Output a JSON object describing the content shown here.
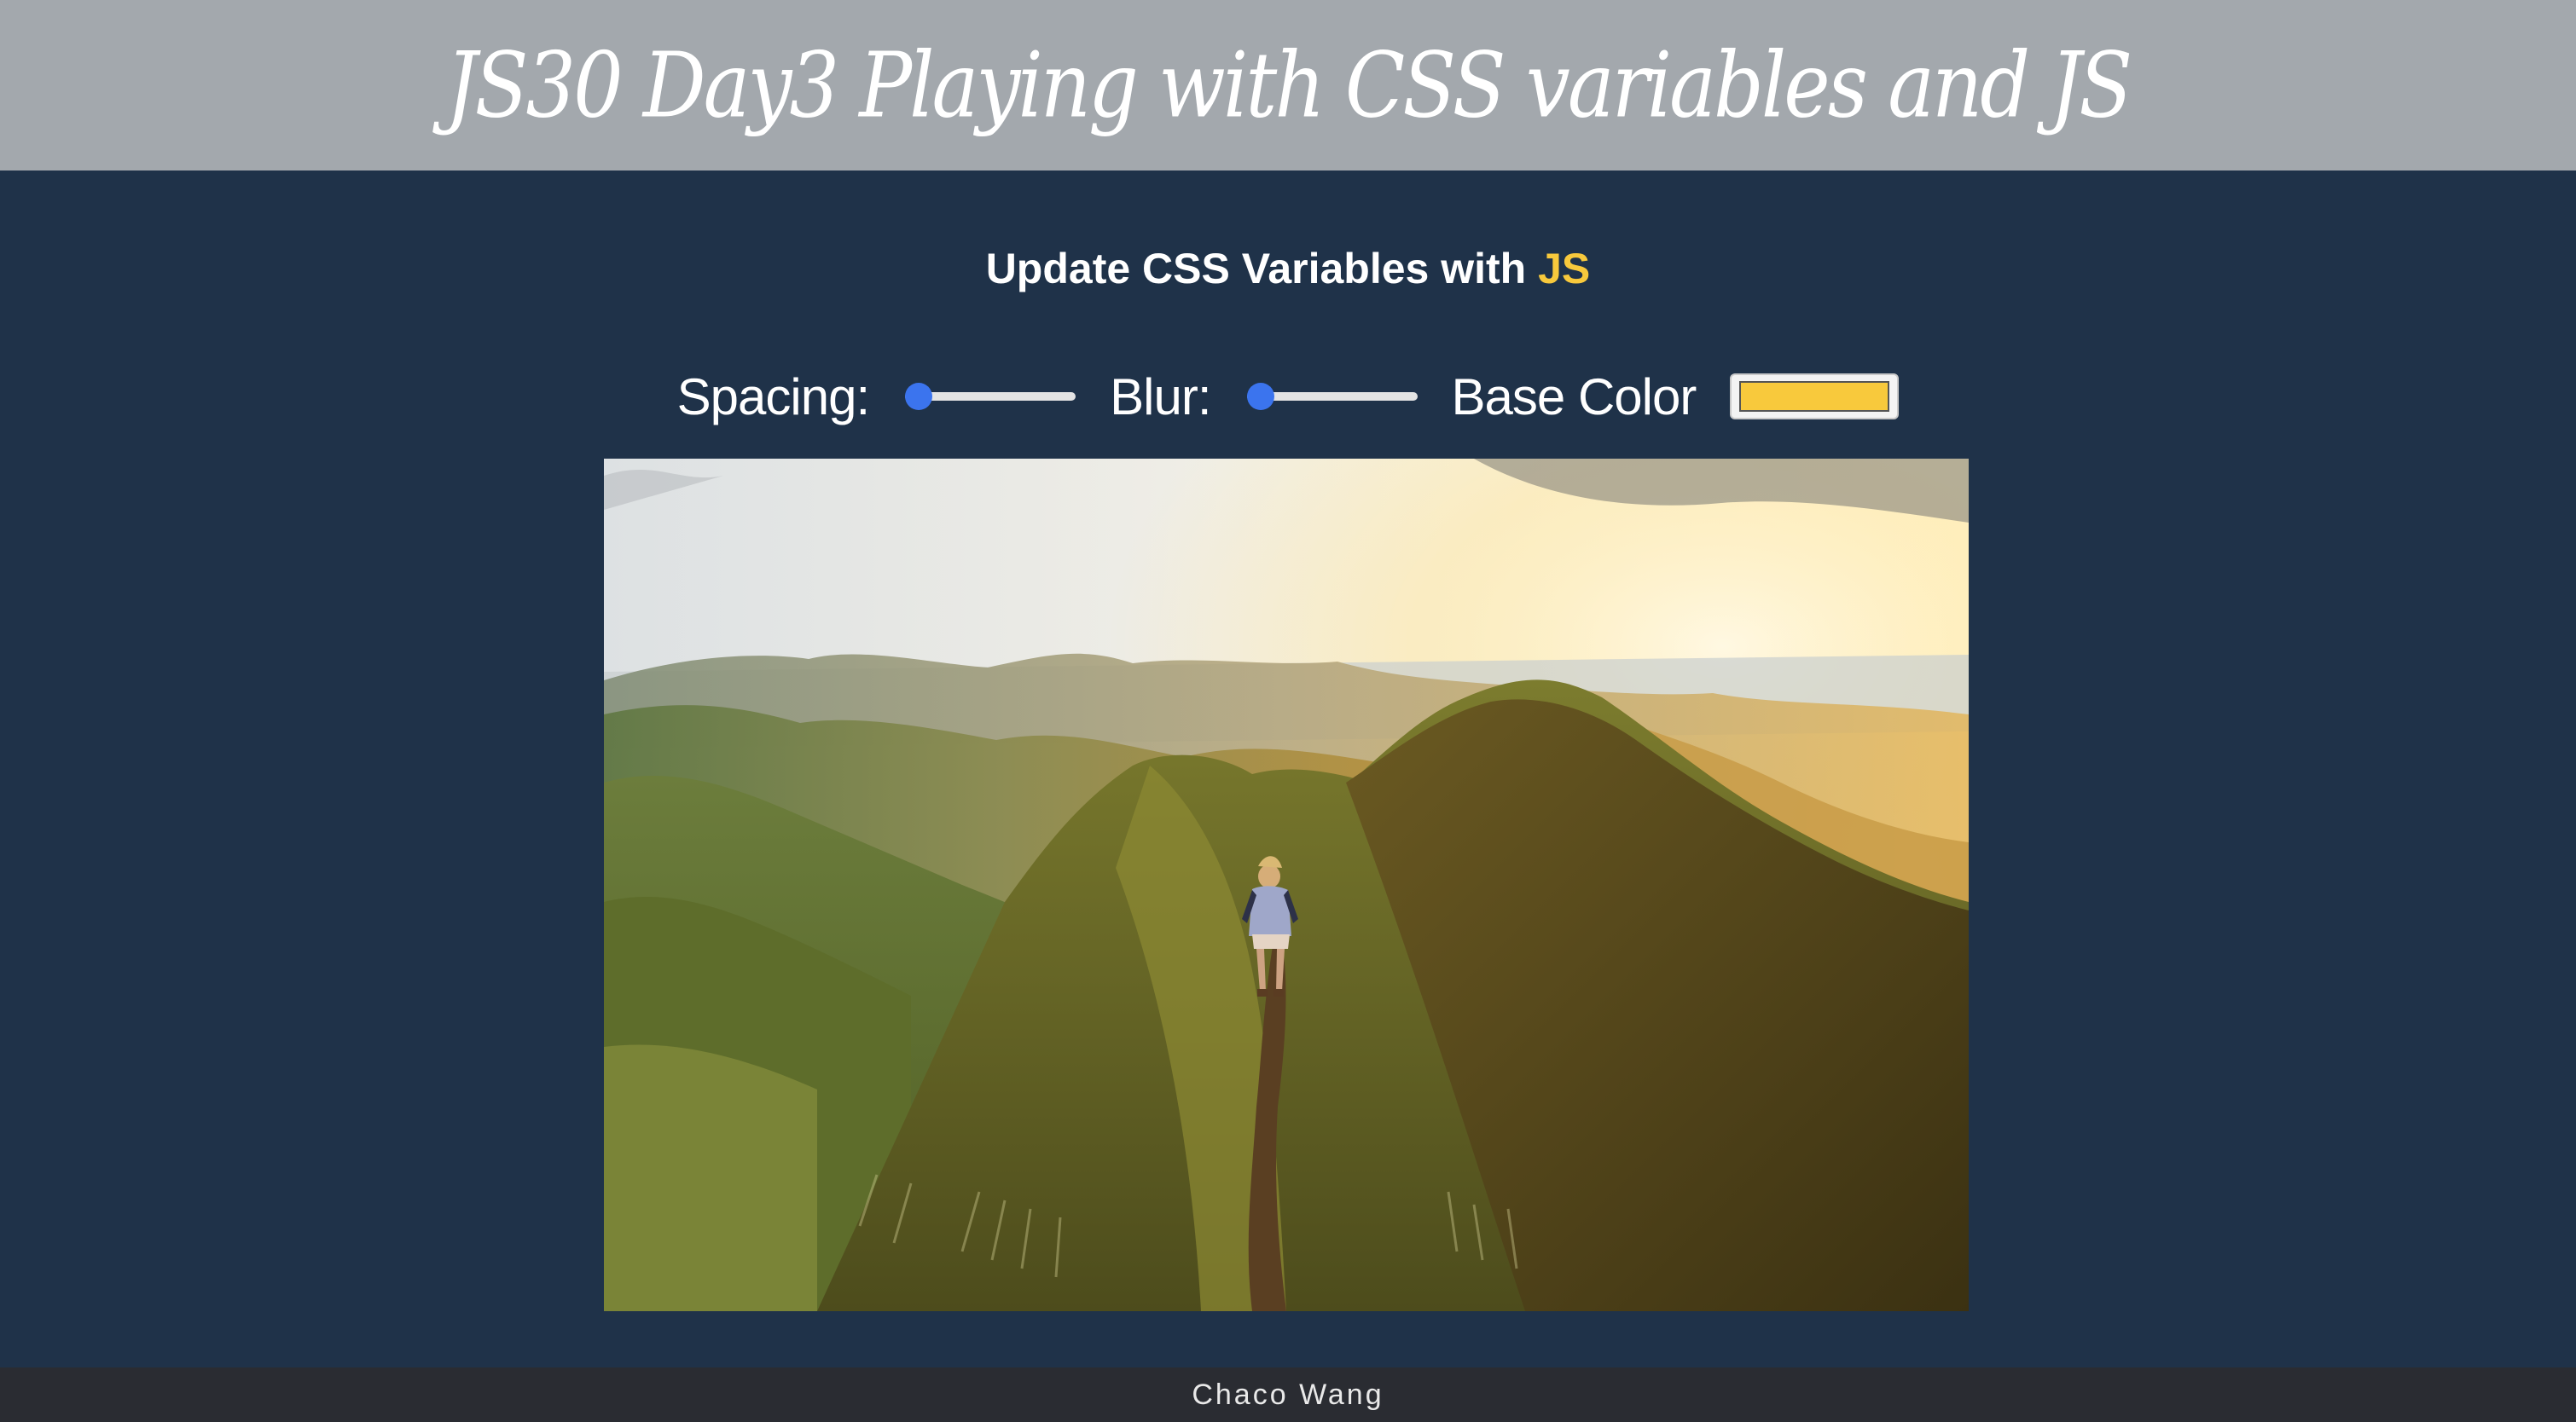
{
  "header": {
    "title": "JS30 Day3 Playing with CSS variables and JS"
  },
  "main": {
    "heading_prefix": "Update CSS Variables with ",
    "heading_highlight": "JS",
    "highlight_color": "#f8c93c"
  },
  "controls": {
    "spacing_label": "Spacing:",
    "spacing_value": 0,
    "blur_label": "Blur:",
    "blur_value": 0,
    "base_color_label": "Base Color",
    "base_color_value": "#f8c93c"
  },
  "image": {
    "description_icon": "mountain-photo"
  },
  "footer": {
    "author": "Chaco Wang"
  },
  "colors": {
    "banner": "#a3a8ad",
    "background": "#1f3249",
    "footer": "#2a2c32",
    "slider_thumb": "#3b74ee"
  }
}
